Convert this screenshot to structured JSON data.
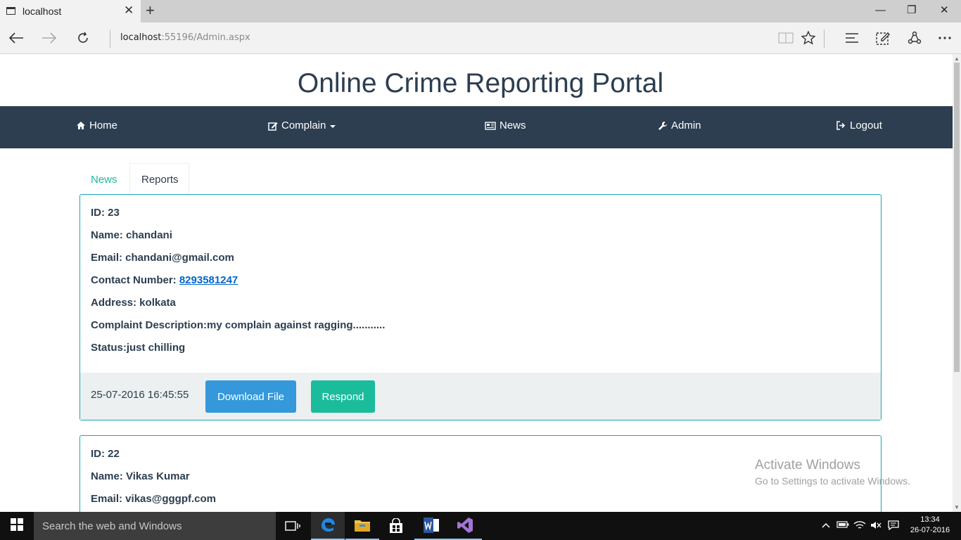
{
  "browser": {
    "tab_title": "localhost",
    "tab_close": "✕",
    "new_tab": "+",
    "url_host": "localhost",
    "url_rest": ":55196/Admin.aspx",
    "window_controls": {
      "minimize": "—",
      "maximize": "❐",
      "close": "✕"
    }
  },
  "site": {
    "title": "Online Crime Reporting Portal"
  },
  "navbar": {
    "items": [
      {
        "label": "Home",
        "icon": "home-icon"
      },
      {
        "label": "Complain",
        "icon": "edit-icon",
        "dropdown": true
      },
      {
        "label": "News",
        "icon": "newspaper-icon"
      },
      {
        "label": "Admin",
        "icon": "wrench-icon"
      },
      {
        "label": "Logout",
        "icon": "sign-out-icon"
      }
    ]
  },
  "tabs": {
    "news": "News",
    "reports": "Reports",
    "active": "Reports"
  },
  "reports": [
    {
      "id_text": "ID: 23",
      "name_text": "Name: chandani",
      "email_text": "Email: chandani@gmail.com",
      "contact_label": "Contact Number: ",
      "contact_number": "8293581247",
      "address_text": "Address: kolkata",
      "description_text": "Complaint Description:my complain against ragging...........",
      "status_text": "Status:just chilling",
      "timestamp": "25-07-2016 16:45:55",
      "download_label": "Download File",
      "respond_label": "Respond"
    },
    {
      "id_text": "ID: 22",
      "name_text": "Name: Vikas Kumar",
      "email_text": "Email: vikas@gggpf.com"
    }
  ],
  "watermark": {
    "title": "Activate Windows",
    "subtitle": "Go to Settings to activate Windows."
  },
  "taskbar": {
    "search_placeholder": "Search the web and Windows",
    "time": "13:34",
    "date": "26-07-2016"
  },
  "colors": {
    "navbar": "#2c3e50",
    "accent_teal": "#18bc9c",
    "download_button": "#3498db",
    "respond_button": "#1abc9c",
    "card_border": "#18a7b5",
    "footer_bg": "#ecf0f1"
  }
}
